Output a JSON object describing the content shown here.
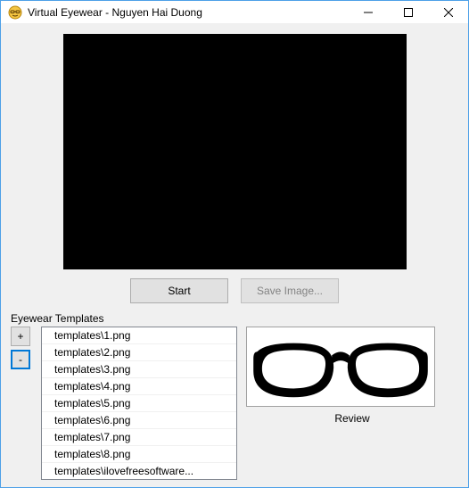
{
  "window": {
    "title": "Virtual Eyewear - Nguyen Hai Duong"
  },
  "buttons": {
    "start": "Start",
    "save_image": "Save Image..."
  },
  "section": {
    "templates_label": "Eyewear Templates"
  },
  "pm": {
    "plus": "+",
    "minus": "-"
  },
  "templates": [
    "templates\\1.png",
    "templates\\2.png",
    "templates\\3.png",
    "templates\\4.png",
    "templates\\5.png",
    "templates\\6.png",
    "templates\\7.png",
    "templates\\8.png",
    "templates\\ilovefreesoftware..."
  ],
  "review": {
    "label": "Review"
  }
}
